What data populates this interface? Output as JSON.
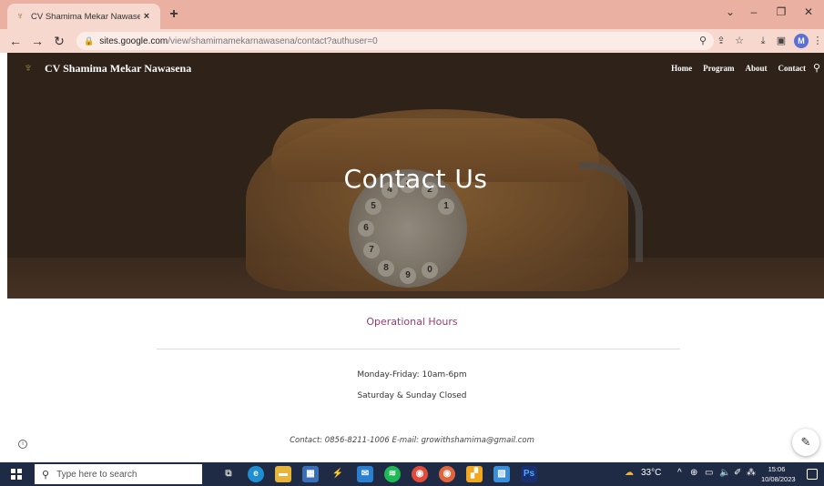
{
  "browser": {
    "tab_title": "CV Shamima Mekar Nawasena - ",
    "tab_close": "×",
    "new_tab": "+",
    "window_controls": {
      "more": "⌄",
      "minimize": "–",
      "restore": "❐",
      "close": "✕"
    },
    "url_host": "sites.google.com",
    "url_path": "/view/shamimamekarnawasena/contact?authuser=0",
    "profile_initial": "M",
    "icons": [
      "zoom-icon",
      "share-icon",
      "bookmark-star-icon",
      "download-icon",
      "sidepanel-icon",
      "profile-icon",
      "menu-icon"
    ]
  },
  "site": {
    "title": "CV Shamima Mekar Nawasena",
    "nav": [
      "Home",
      "Program",
      "About",
      "Contact"
    ],
    "hero_title": "Contact Us",
    "section_title": "Operational Hours",
    "hours_weekday": "Monday-Friday: 10am-6pm",
    "hours_weekend": "Saturday & Sunday Closed",
    "contact_line": "Contact: 0856-8211-1006 E-mail: growithshamima@gmail.com"
  },
  "taskbar": {
    "search_placeholder": "Type here to search",
    "weather": "33°C",
    "time": "15:06",
    "date": "10/08/2023"
  },
  "colors": {
    "tab_bar": "#eab0a2",
    "accent_title": "#9a3a70",
    "taskbar": "#1f2a44"
  }
}
